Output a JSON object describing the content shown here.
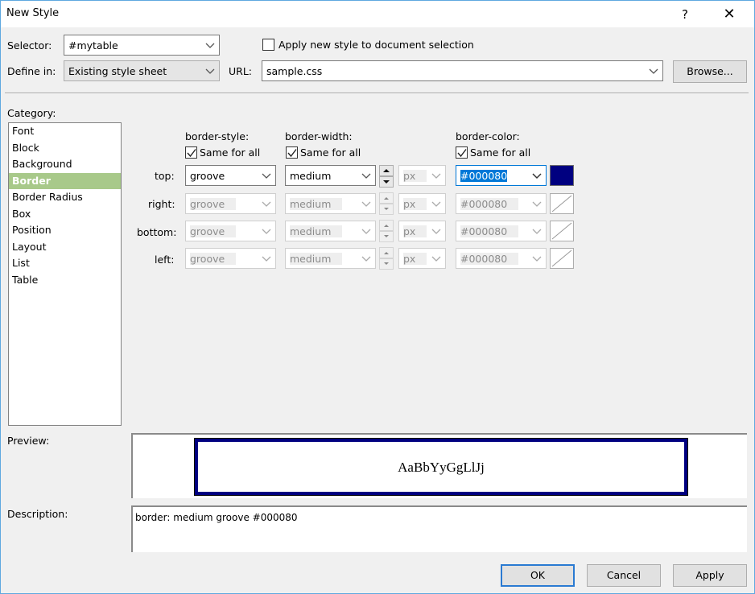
{
  "window": {
    "title": "New Style",
    "help_label": "?",
    "close_label": "✕"
  },
  "selector": {
    "label": "Selector:",
    "value": "#mytable",
    "apply_checkbox_label": "Apply new style to document selection",
    "apply_checked": false
  },
  "define_in": {
    "label": "Define in:",
    "value": "Existing style sheet",
    "url_label": "URL:",
    "url_value": "sample.css",
    "browse_label": "Browse..."
  },
  "category": {
    "label": "Category:",
    "items": [
      {
        "label": "Font",
        "selected": false
      },
      {
        "label": "Block",
        "selected": false
      },
      {
        "label": "Background",
        "selected": false
      },
      {
        "label": "Border",
        "selected": true
      },
      {
        "label": "Border Radius",
        "selected": false
      },
      {
        "label": "Box",
        "selected": false
      },
      {
        "label": "Position",
        "selected": false
      },
      {
        "label": "Layout",
        "selected": false
      },
      {
        "label": "List",
        "selected": false
      },
      {
        "label": "Table",
        "selected": false
      }
    ]
  },
  "border": {
    "style_header": "border-style:",
    "width_header": "border-width:",
    "color_header": "border-color:",
    "same_for_all_label": "Same for all",
    "style_same": true,
    "width_same": true,
    "color_same": true,
    "rows": [
      {
        "side": "top:",
        "style": "groove",
        "width": "medium",
        "unit": "px",
        "color": "#000080",
        "enabled": true
      },
      {
        "side": "right:",
        "style": "groove",
        "width": "medium",
        "unit": "px",
        "color": "#000080",
        "enabled": false
      },
      {
        "side": "bottom:",
        "style": "groove",
        "width": "medium",
        "unit": "px",
        "color": "#000080",
        "enabled": false
      },
      {
        "side": "left:",
        "style": "groove",
        "width": "medium",
        "unit": "px",
        "color": "#000080",
        "enabled": false
      }
    ],
    "swatch_color": "#000080"
  },
  "preview": {
    "label": "Preview:",
    "sample_text": "AaBbYyGgLlJj"
  },
  "description": {
    "label": "Description:",
    "text": "border: medium groove #000080"
  },
  "buttons": {
    "ok": "OK",
    "cancel": "Cancel",
    "apply": "Apply"
  }
}
